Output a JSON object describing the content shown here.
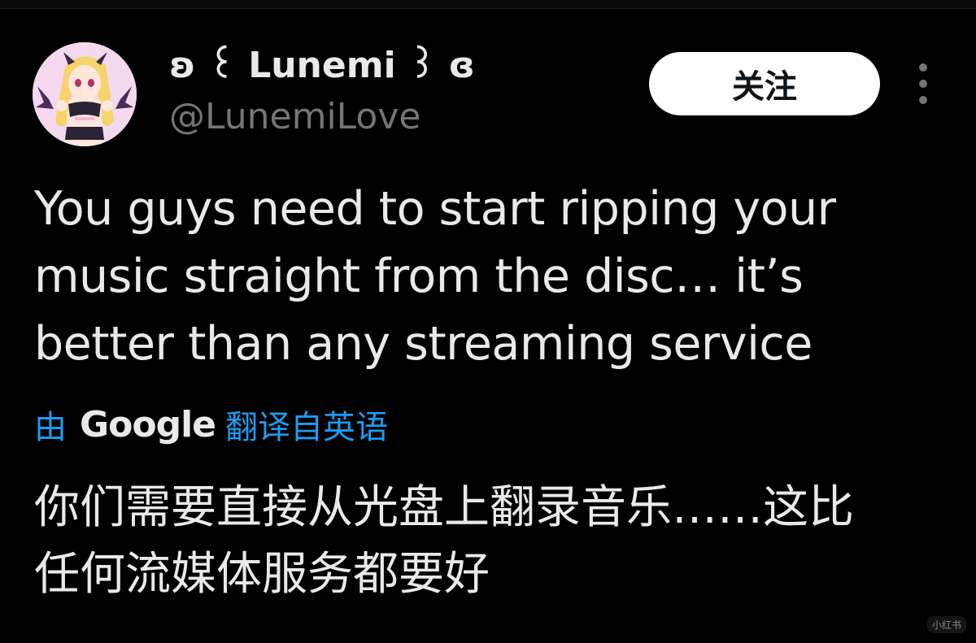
{
  "author": {
    "display_name": "ʚ ꒰ Lunemi ꒱ ɞ",
    "handle": "@LunemiLove",
    "avatar_icon": "anime-avatar-icon"
  },
  "actions": {
    "follow_label": "关注",
    "more_icon": "more-vertical-icon"
  },
  "tweet": {
    "text": "You guys need to start ripping your\nmusic straight from the disc… it’s\nbetter than any streaming service"
  },
  "translation": {
    "prefix": "由",
    "provider": "Google",
    "suffix": "翻译自英语",
    "text": "你们需要直接从光盘上翻录音乐……这比\n任何流媒体服务都要好"
  },
  "watermark": {
    "text": "小红书"
  },
  "colors": {
    "background": "#000000",
    "primary_text": "#e7e9ea",
    "secondary_text": "#71767b",
    "link": "#1d9bf0",
    "follow_button_bg": "#ffffff",
    "follow_button_text": "#0f1419"
  }
}
